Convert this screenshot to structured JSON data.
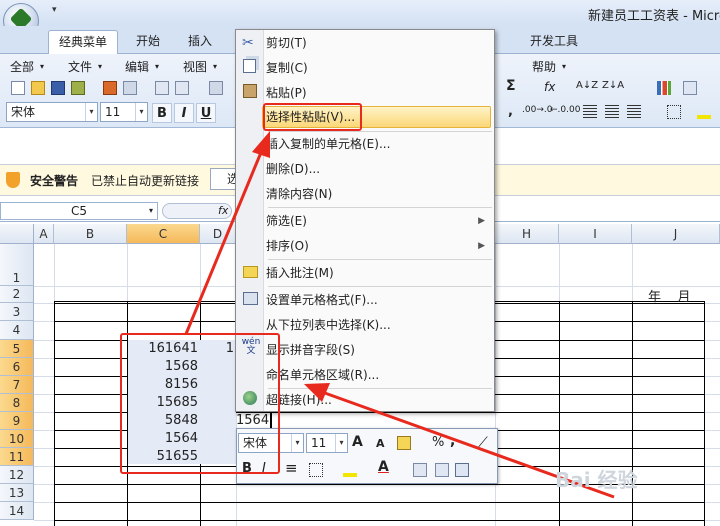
{
  "window": {
    "title": "新建员工工资表 - Micro",
    "qa_dropdown": "▾"
  },
  "tabs": [
    {
      "label": "经典菜单",
      "active": true
    },
    {
      "label": "开始"
    },
    {
      "label": "插入"
    },
    {
      "label": "开发工具"
    }
  ],
  "menubar": [
    "全部",
    "文件",
    "编辑",
    "视图",
    "帮助"
  ],
  "ribbon": {
    "font_name": "宋体",
    "font_size": "11",
    "bold": "B",
    "italic": "I",
    "underline": "U",
    "sigma": "Σ",
    "fx": "fx",
    "comma": ",",
    "dec_inc": ".00→.0",
    "dec_dec": "←.0.00",
    "sort_az": "A↓Z",
    "sort_za": "Z↓A"
  },
  "security": {
    "title": "安全警告",
    "message": "已禁止自动更新链接",
    "button": "选"
  },
  "formula": {
    "name_box": "C5",
    "fx": "fx"
  },
  "columns": [
    "A",
    "B",
    "C",
    "D",
    "H",
    "I",
    "J"
  ],
  "rows": [
    "1",
    "2",
    "3",
    "4",
    "5",
    "6",
    "7",
    "8",
    "9",
    "10",
    "11",
    "12",
    "13",
    "14"
  ],
  "sheet": {
    "header_right": "年    月",
    "c_values": [
      "161641",
      "1568",
      "8156",
      "15685",
      "5848",
      "1564",
      "51655"
    ],
    "d_partial": "1",
    "d9_value": "1564"
  },
  "context_menu": {
    "items": [
      {
        "label": "剪切(T)",
        "icon": "scissors-icon"
      },
      {
        "label": "复制(C)",
        "icon": "copy-icon"
      },
      {
        "label": "粘贴(P)",
        "icon": "paste-icon"
      },
      {
        "label": "选择性粘贴(V)...",
        "highlighted": true
      },
      {
        "label": "插入复制的单元格(E)..."
      },
      {
        "label": "删除(D)..."
      },
      {
        "label": "清除内容(N)"
      },
      {
        "label": "筛选(E)",
        "submenu": true
      },
      {
        "label": "排序(O)",
        "submenu": true
      },
      {
        "label": "插入批注(M)",
        "icon": "comment-icon"
      },
      {
        "label": "设置单元格格式(F)...",
        "icon": "format-cells-icon"
      },
      {
        "label": "从下拉列表中选择(K)..."
      },
      {
        "label": "显示拼音字段(S)",
        "icon": "pinyin-icon"
      },
      {
        "label": "命名单元格区域(R)..."
      },
      {
        "label": "超链接(H)...",
        "icon": "hyperlink-icon"
      }
    ],
    "submenu_arrow": "▶",
    "pinyin_glyph": "wén 文"
  },
  "mini_toolbar": {
    "font": "宋体",
    "size": "11",
    "grow": "A",
    "shrink": "A",
    "percent": "%",
    "comma": ",",
    "bold": "B",
    "italic": "I",
    "align": "≡",
    "font_color": "A"
  },
  "watermark": "Bai 经验",
  "colors": {
    "accent_red": "#e8291e",
    "menu_highlight": "#fbd777",
    "selected_header": "#f5b95a"
  }
}
